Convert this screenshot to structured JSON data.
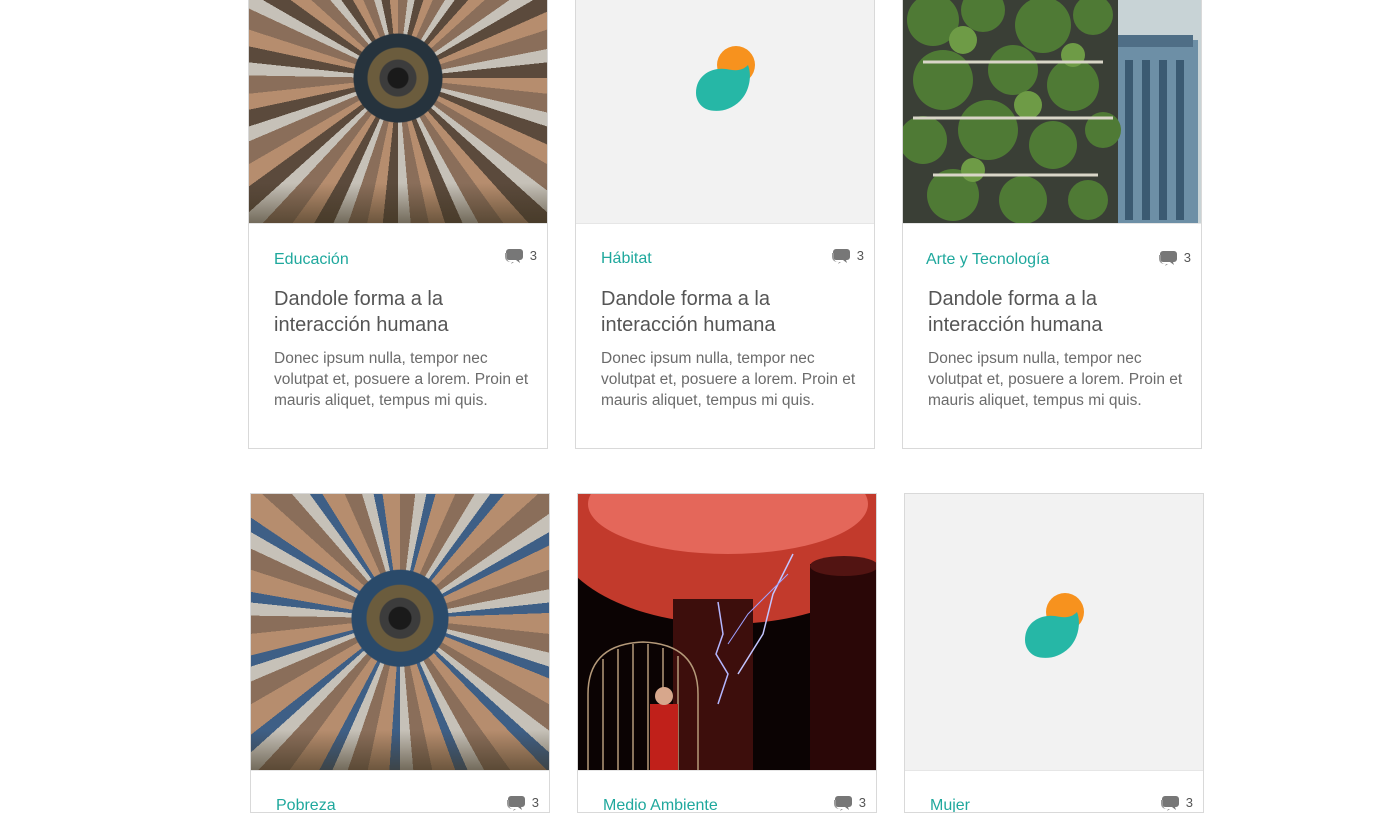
{
  "cards": [
    {
      "category": "Educación",
      "comments": "3",
      "title": "Dandole forma a la interacción humana",
      "excerpt": "Donec ipsum nulla, tempor nec volutpat et, posuere a lorem. Proin et mauris aliquet, tempus mi quis.",
      "image": "particle-detector-photo"
    },
    {
      "category": "Hábitat",
      "comments": "3",
      "title": "Dandole forma a la interacción humana",
      "excerpt": "Donec ipsum nulla, tempor nec volutpat et, posuere a lorem. Proin et mauris aliquet, tempus mi quis.",
      "image": "logo-placeholder"
    },
    {
      "category": "Arte y Tecnología",
      "comments": "3",
      "title": "Dandole forma a la interacción humana",
      "excerpt": "Donec ipsum nulla, tempor nec volutpat et, posuere a lorem. Proin et mauris aliquet, tempus mi quis.",
      "image": "vertical-forest-building-photo"
    },
    {
      "category": "Pobreza",
      "comments": "3",
      "image": "particle-detector-photo"
    },
    {
      "category": "Medio Ambiente",
      "comments": "3",
      "image": "tesla-coil-photo"
    },
    {
      "category": "Mujer",
      "comments": "3",
      "image": "logo-placeholder"
    }
  ],
  "colors": {
    "accent": "#1fa89d",
    "logo_teal": "#26b7a6",
    "logo_orange": "#f7921e",
    "text_dark": "#555555",
    "text_body": "#6b6b6b",
    "border": "#d9d9d9"
  },
  "icons": {
    "comment": "speech-bubbles-icon"
  }
}
